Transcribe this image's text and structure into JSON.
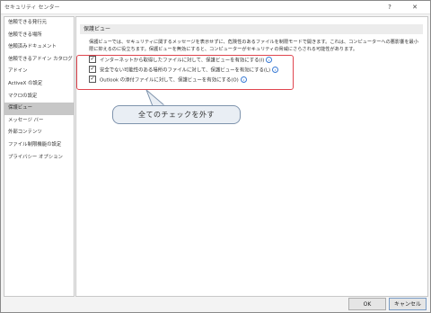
{
  "window": {
    "title": "セキュリティ センター",
    "help_label": "?",
    "close_label": "✕"
  },
  "sidebar": {
    "items": [
      {
        "label": "信頼できる発行元",
        "active": false
      },
      {
        "label": "信頼できる場所",
        "active": false
      },
      {
        "label": "信頼済みドキュメント",
        "active": false
      },
      {
        "label": "信頼できるアドイン カタログ",
        "active": false
      },
      {
        "label": "アドイン",
        "active": false
      },
      {
        "label": "ActiveX の設定",
        "active": false
      },
      {
        "label": "マクロの設定",
        "active": false
      },
      {
        "label": "保護ビュー",
        "active": true
      },
      {
        "label": "メッセージ バー",
        "active": false
      },
      {
        "label": "外部コンテンツ",
        "active": false
      },
      {
        "label": "ファイル制限機能の設定",
        "active": false
      },
      {
        "label": "プライバシー オプション",
        "active": false
      }
    ]
  },
  "main": {
    "section_title": "保護ビュー",
    "description": "保護ビューでは、セキュリティに関するメッセージを表示せずに、危険性のあるファイルを制限モードで開きます。これは、コンピューターへの悪影響を最小限に抑えるのに役立ちます。保護ビューを無効にすると、コンピューターがセキュリティの脅威にさらされる可能性があります。",
    "options": [
      {
        "label": "インターネットから取得したファイルに対して、保護ビューを有効にする(I)",
        "checked": true
      },
      {
        "label": "安全でない可能性のある場所のファイルに対して、保護ビューを有効にする(L)",
        "checked": true
      },
      {
        "label": "Outlook の添付ファイルに対して、保護ビューを有効にする(O)",
        "checked": true
      }
    ],
    "check_glyph": "✓",
    "info_glyph": "i"
  },
  "annotation": {
    "callout_text": "全てのチェックを外す",
    "highlight_color": "#e0454f"
  },
  "footer": {
    "ok_label": "OK",
    "cancel_label": "キャンセル"
  }
}
